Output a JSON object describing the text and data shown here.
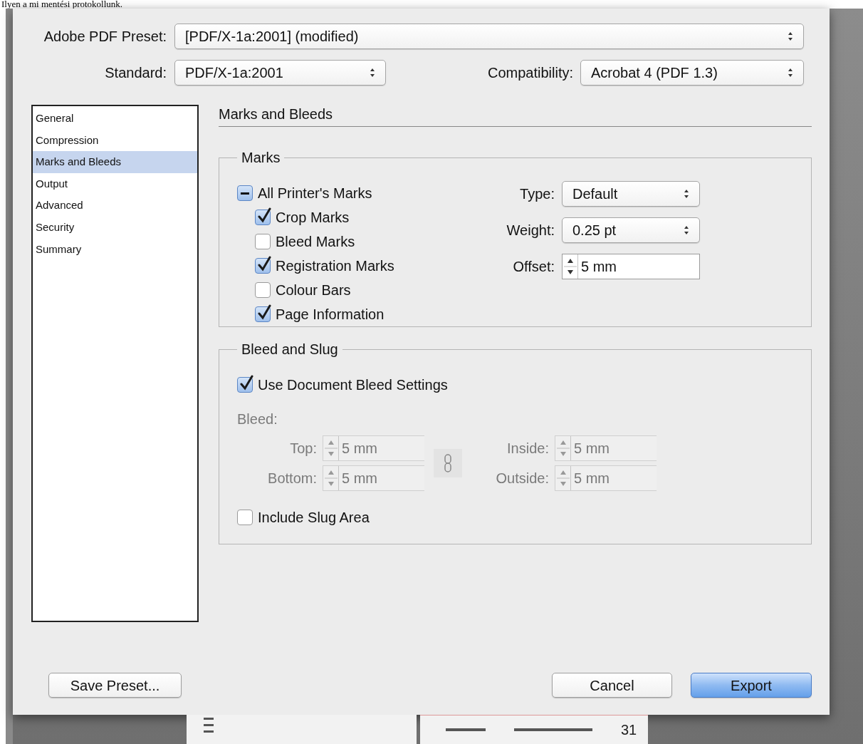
{
  "caption": "Ilyen a mi mentési protokollunk.",
  "preset": {
    "label": "Adobe PDF Preset:",
    "value": "[PDF/X-1a:2001] (modified)"
  },
  "standard": {
    "label": "Standard:",
    "value": "PDF/X-1a:2001"
  },
  "compatibility": {
    "label": "Compatibility:",
    "value": "Acrobat 4 (PDF 1.3)"
  },
  "sidebar": {
    "items": [
      {
        "label": "General",
        "selected": false
      },
      {
        "label": "Compression",
        "selected": false
      },
      {
        "label": "Marks and Bleeds",
        "selected": true
      },
      {
        "label": "Output",
        "selected": false
      },
      {
        "label": "Advanced",
        "selected": false
      },
      {
        "label": "Security",
        "selected": false
      },
      {
        "label": "Summary",
        "selected": false
      }
    ]
  },
  "section_title": "Marks and Bleeds",
  "marks": {
    "title": "Marks",
    "all": {
      "label": "All Printer's Marks",
      "indeterminate": true
    },
    "items": [
      {
        "label": "Crop Marks",
        "checked": true
      },
      {
        "label": "Bleed Marks",
        "checked": false
      },
      {
        "label": "Registration Marks",
        "checked": true
      },
      {
        "label": "Colour Bars",
        "checked": false
      },
      {
        "label": "Page Information",
        "checked": true
      }
    ],
    "type": {
      "label": "Type:",
      "value": "Default"
    },
    "weight": {
      "label": "Weight:",
      "value": "0.25 pt"
    },
    "offset": {
      "label": "Offset:",
      "value": "5 mm"
    }
  },
  "bleed_and_slug": {
    "title": "Bleed and Slug",
    "use_document": {
      "label": "Use Document Bleed Settings",
      "checked": true
    },
    "bleed_label": "Bleed:",
    "disabled": true,
    "fields": [
      {
        "label": "Top:",
        "value": "5 mm"
      },
      {
        "label": "Inside:",
        "value": "5 mm"
      },
      {
        "label": "Bottom:",
        "value": "5 mm"
      },
      {
        "label": "Outside:",
        "value": "5 mm"
      }
    ],
    "include_slug": {
      "label": "Include Slug Area",
      "checked": false
    }
  },
  "buttons": [
    {
      "label": "Save Preset...",
      "kind": "default"
    },
    {
      "label": "Cancel",
      "kind": "default"
    },
    {
      "label": "Export",
      "kind": "primary"
    }
  ],
  "background": {
    "page_number": "31"
  }
}
